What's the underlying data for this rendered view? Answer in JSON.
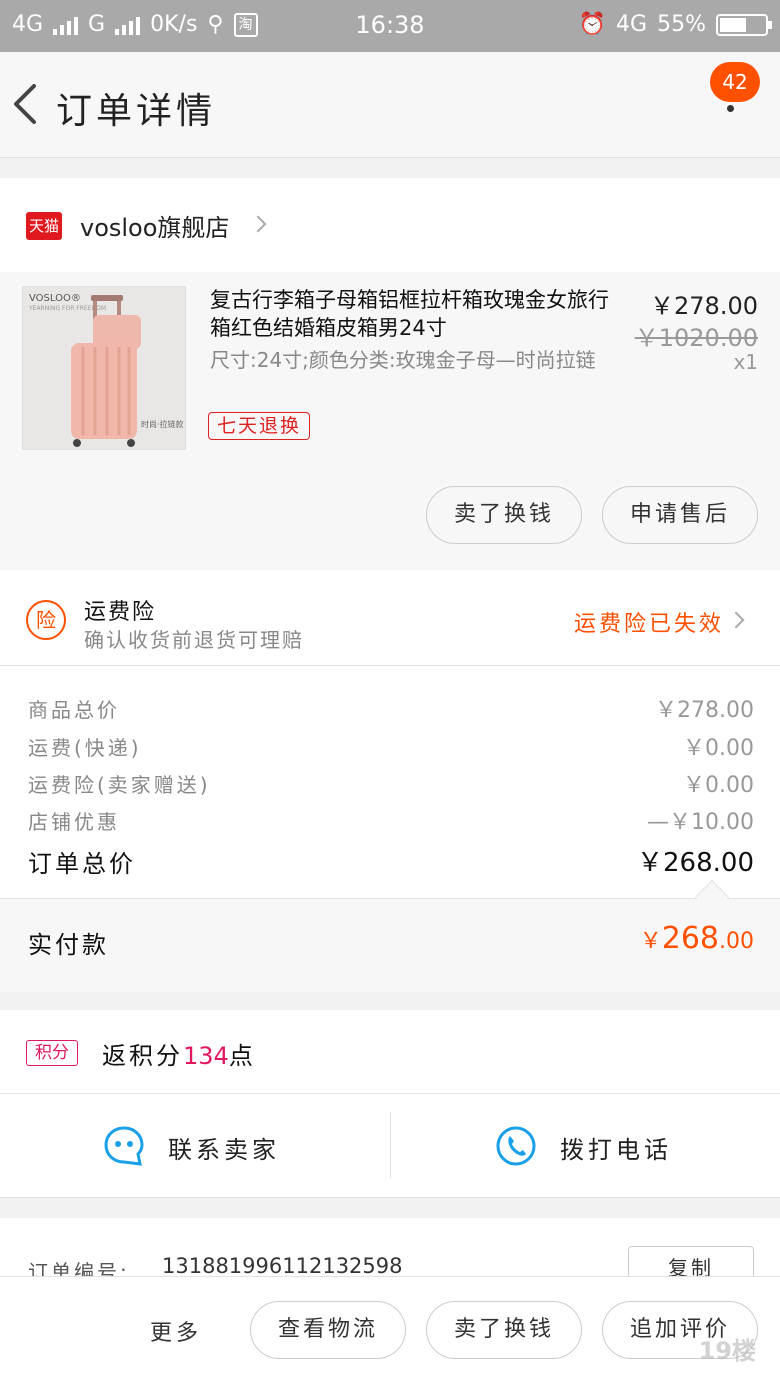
{
  "status_bar": {
    "network1": "4G",
    "network2": "G",
    "speed": "0K/s",
    "app_icon_text": "淘",
    "time": "16:38",
    "network3": "4G",
    "battery": "55%"
  },
  "header": {
    "title": "订单详情",
    "badge_count": "42"
  },
  "shop": {
    "tag": "天猫",
    "name": "vosloo旗舰店"
  },
  "product": {
    "image_brand": "VOSLOO®",
    "image_brand_sub": "YEARNING FOR FREEDOM",
    "image_caption": "时尚·拉链款",
    "title": "复古行李箱子母箱铝框拉杆箱玫瑰金女旅行箱红色结婚箱皮箱男24寸",
    "sku": "尺寸:24寸;颜色分类:玫瑰金子母—时尚拉链",
    "return_tag": "七天退换",
    "price": "￥278.00",
    "original_price": "￥1020.00",
    "quantity": "x1",
    "btn_resell": "卖了换钱",
    "btn_aftersale": "申请售后"
  },
  "insurance": {
    "icon_text": "险",
    "title": "运费险",
    "desc": "确认收货前退货可理赔",
    "status": "运费险已失效"
  },
  "summary": {
    "rows": [
      {
        "label": "商品总价",
        "value": "￥278.00"
      },
      {
        "label": "运费(快递)",
        "value": "￥0.00"
      },
      {
        "label": "运费险(卖家赠送)",
        "value": "￥0.00"
      },
      {
        "label": "店铺优惠",
        "value": "—￥10.00"
      }
    ],
    "total_label": "订单总价",
    "total_value": "￥268.00",
    "paid_label": "实付款",
    "paid_symbol": "￥",
    "paid_int": "268",
    "paid_dec": ".00"
  },
  "points": {
    "badge": "积分",
    "prefix": "返积分",
    "amount": "134",
    "suffix": "点"
  },
  "contact": {
    "seller_label": "联系卖家",
    "phone_label": "拨打电话"
  },
  "order": {
    "number_label": "订单编号:",
    "number_value": "1318819961121325​98",
    "copy_label": "复制"
  },
  "bottom_bar": {
    "more": "更多",
    "btn_logistics": "查看物流",
    "btn_resell": "卖了换钱",
    "btn_review": "追加评价"
  },
  "watermark": "19楼",
  "colors": {
    "accent": "#ff5000",
    "tmall_red": "#e0191e",
    "points_pink": "#e0195a",
    "contact_blue": "#1aa0e8"
  }
}
